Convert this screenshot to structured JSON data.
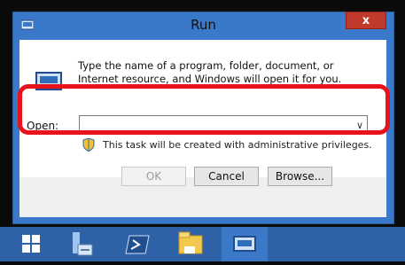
{
  "window": {
    "title": "Run",
    "close_label": "x"
  },
  "dialog": {
    "description": "Type the name of a program, folder, document, or Internet resource, and Windows will open it for you.",
    "open_label": "Open:",
    "open_value": "",
    "admin_note": "This task will be created with administrative privileges."
  },
  "buttons": {
    "ok": "OK",
    "cancel": "Cancel",
    "browse": "Browse..."
  },
  "taskbar": {
    "items": [
      "start-icon",
      "server-manager-icon",
      "powershell-icon",
      "file-explorer-icon",
      "run-icon"
    ]
  },
  "colors": {
    "window_frame": "#3a79c9",
    "taskbar": "#2e61a6",
    "highlight": "#e8121b",
    "close": "#c0392b"
  }
}
